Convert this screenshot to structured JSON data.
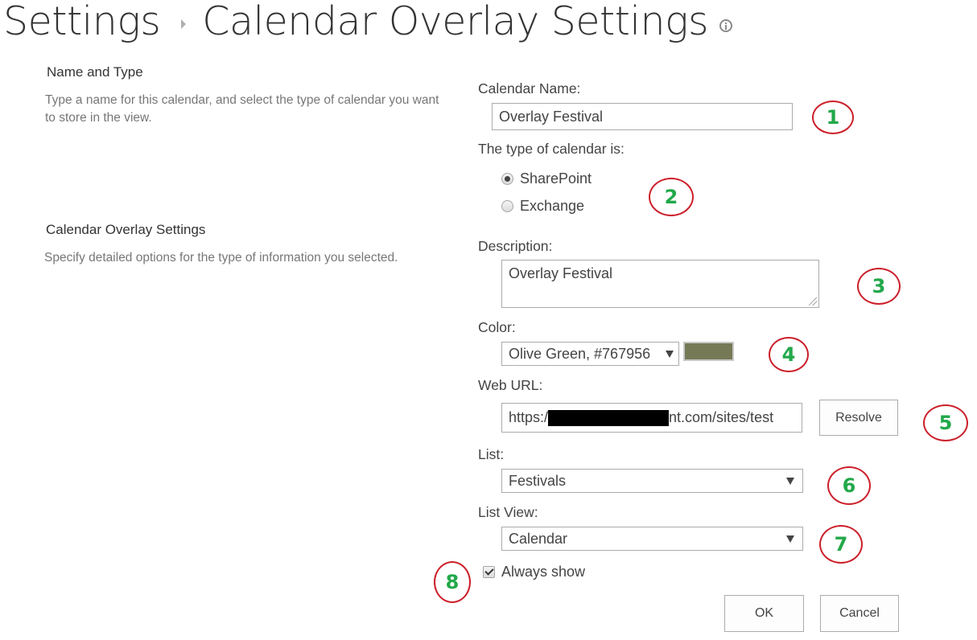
{
  "header": {
    "breadcrumb_root": "Settings",
    "page_title": "Calendar Overlay Settings",
    "info_icon": "info-icon"
  },
  "sections": [
    {
      "heading": "Name and Type",
      "description": "Type a name for this calendar, and select the type of calendar you want to store in the view."
    },
    {
      "heading": "Calendar Overlay Settings",
      "description": "Specify detailed options for the type of information you selected."
    }
  ],
  "form": {
    "calendar_name": {
      "label": "Calendar Name:",
      "value": "Overlay Festival"
    },
    "calendar_type": {
      "label": "The type of calendar is:",
      "options": [
        {
          "label": "SharePoint",
          "selected": true
        },
        {
          "label": "Exchange",
          "selected": false
        }
      ]
    },
    "description": {
      "label": "Description:",
      "value": "Overlay Festival"
    },
    "color": {
      "label": "Color:",
      "selected": "Olive Green, #767956",
      "swatch_hex": "#767956"
    },
    "web_url": {
      "label": "Web URL:",
      "value_prefix": "https:/",
      "value_suffix": "nt.com/sites/test",
      "redacted": true,
      "resolve_label": "Resolve"
    },
    "list": {
      "label": "List:",
      "selected": "Festivals"
    },
    "list_view": {
      "label": "List View:",
      "selected": "Calendar"
    },
    "always_show": {
      "label": "Always show",
      "checked": true
    },
    "ok_label": "OK",
    "cancel_label": "Cancel"
  },
  "annotations": [
    "1",
    "2",
    "3",
    "4",
    "5",
    "6",
    "7",
    "8"
  ],
  "colors": {
    "annotation_ring": "#cc1f2a",
    "annotation_number": "#22a84a"
  }
}
